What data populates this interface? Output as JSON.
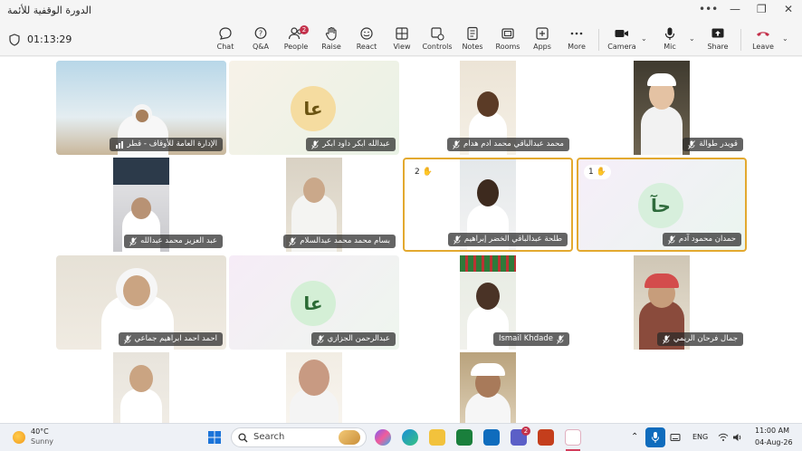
{
  "window": {
    "title": "الدورة الوقفية للأئمة",
    "controls": [
      "more-icon",
      "minimize-icon",
      "restore-icon",
      "close-icon"
    ]
  },
  "meeting": {
    "timer": "01:13:29"
  },
  "toolbar": {
    "chat": "Chat",
    "qa": "Q&A",
    "people": "People",
    "people_badge": "2",
    "raise": "Raise",
    "react": "React",
    "view": "View",
    "controls": "Controls",
    "notes": "Notes",
    "rooms": "Rooms",
    "apps": "Apps",
    "more": "More",
    "camera": "Camera",
    "mic": "Mic",
    "share": "Share",
    "leave": "Leave"
  },
  "participants": [
    {
      "name": "الإدارة العامة للأوقاف - قطر",
      "raised": "",
      "avatar": ""
    },
    {
      "name": "عبدالله ابكر داود ابكر",
      "raised": "",
      "avatar": "عا"
    },
    {
      "name": "محمد عبدالباقي محمد ادم هدام",
      "raised": "",
      "avatar": ""
    },
    {
      "name": "قويدر طوالة",
      "raised": "",
      "avatar": ""
    },
    {
      "name": "عبد العزيز محمد عبدالله",
      "raised": "",
      "avatar": ""
    },
    {
      "name": "بسام محمد محمد عبدالسلام",
      "raised": "",
      "avatar": ""
    },
    {
      "name": "طلحة عبدالباقي الخضر إبراهيم",
      "raised": "2",
      "avatar": ""
    },
    {
      "name": "حمدان محمود آدم",
      "raised": "1",
      "avatar": "حآ"
    },
    {
      "name": "احمد احمد ابراهيم جماعي",
      "raised": "",
      "avatar": ""
    },
    {
      "name": "عبدالرحمن الجزازي",
      "raised": "",
      "avatar": "عا"
    },
    {
      "name": "Ismail Khdade",
      "raised": "",
      "avatar": ""
    },
    {
      "name": "جمال فرحان الريمي",
      "raised": "",
      "avatar": ""
    },
    {
      "name": "",
      "raised": "",
      "avatar": ""
    },
    {
      "name": "",
      "raised": "",
      "avatar": ""
    },
    {
      "name": "",
      "raised": "",
      "avatar": ""
    },
    {
      "name": "",
      "raised": "",
      "avatar": ""
    }
  ],
  "taskbar": {
    "weather_temp": "40°C",
    "weather_desc": "Sunny",
    "search_placeholder": "Search",
    "lang": "ENG",
    "time": "11:00 AM",
    "date": "04-Aug-26",
    "teams_badge": "2"
  }
}
